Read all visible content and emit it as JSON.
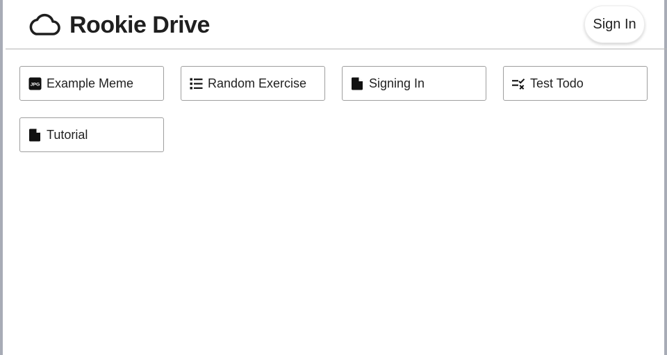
{
  "header": {
    "title": "Rookie Drive",
    "logo_icon": "cloud-icon",
    "signin_label": "Sign In"
  },
  "files": [
    {
      "name": "Example Meme",
      "icon": "jpg-file-icon",
      "icon_text": "JPG"
    },
    {
      "name": "Random Exercise",
      "icon": "list-icon"
    },
    {
      "name": "Signing In",
      "icon": "document-icon"
    },
    {
      "name": "Test Todo",
      "icon": "checklist-icon"
    },
    {
      "name": "Tutorial",
      "icon": "document-icon"
    }
  ],
  "colors": {
    "text": "#1f1f1f",
    "border": "#9e9e9e",
    "frame": "#a8acb6",
    "divider": "#b4b4b4"
  }
}
